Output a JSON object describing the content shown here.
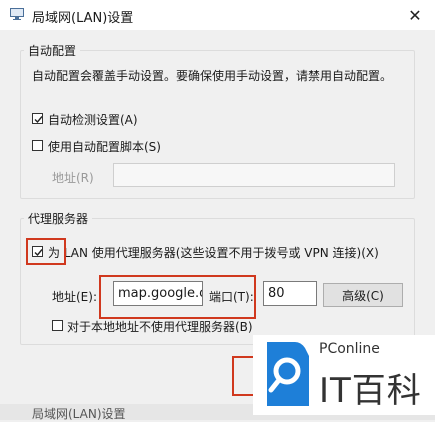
{
  "window": {
    "title": "局域网(LAN)设置",
    "close_glyph": "✕",
    "icon_name": "network-adapter-icon"
  },
  "auto_config": {
    "group_title": "自动配置",
    "description": "自动配置会覆盖手动设置。要确保使用手动设置，请禁用自动配置。",
    "auto_detect": {
      "label": "自动检测设置(A)",
      "checked": true
    },
    "use_script": {
      "label": "使用自动配置脚本(S)",
      "checked": false
    },
    "address_label": "地址(R)",
    "address_value": ""
  },
  "proxy": {
    "group_title": "代理服务器",
    "use_proxy": {
      "label": "为 LAN 使用代理服务器(这些设置不用于拨号或 VPN 连接)(X)",
      "checked": true
    },
    "address_label": "地址(E):",
    "address_value": "map.google.co",
    "port_label": "端口(T):",
    "port_value": "80",
    "advanced_button": "高级(C)",
    "bypass_local": {
      "label": "对于本地地址不使用代理服务器(B)",
      "checked": false
    }
  },
  "colors": {
    "highlight": "#d0381e",
    "logo_blue": "#1e7fd8",
    "dialog_bg": "#f0f0f0"
  },
  "watermark": {
    "brand_en": "PConline",
    "brand_cn": "IT百科"
  },
  "background_window_title": "局域网(LAN)设置"
}
